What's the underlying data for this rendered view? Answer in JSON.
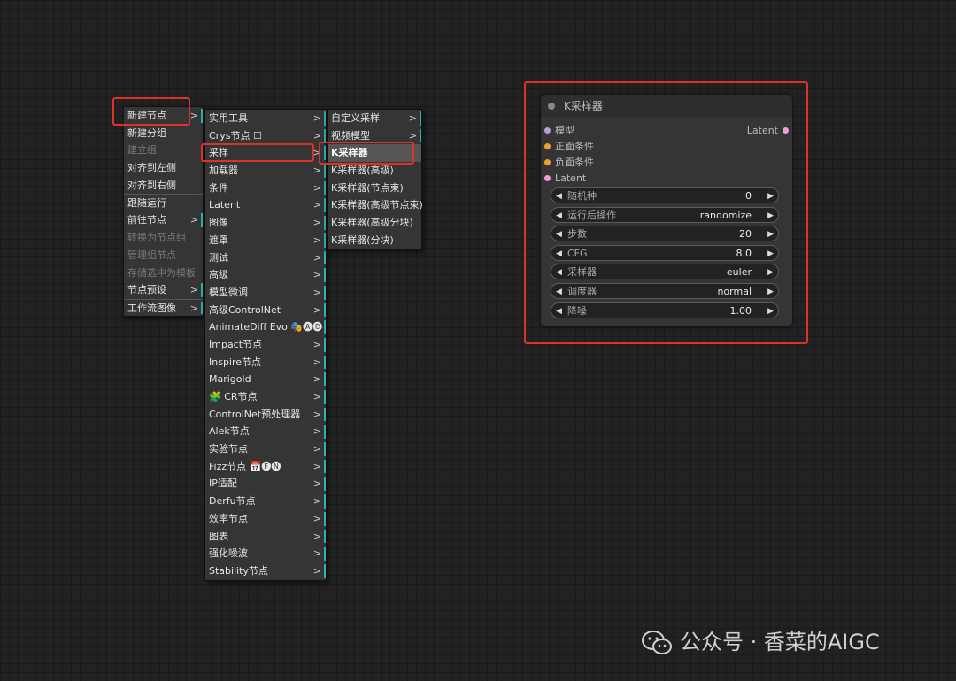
{
  "menu1": {
    "items": [
      {
        "label": "新建节点",
        "arrow": ">",
        "bar": true
      },
      {
        "label": "新建分组"
      },
      {
        "label": "建立组",
        "disabled": true
      },
      {
        "label": "对齐到左侧"
      },
      {
        "label": "对齐到右侧"
      },
      {
        "label": "跟随运行",
        "sep": true
      },
      {
        "label": "前往节点",
        "arrow": ">",
        "bar": true
      },
      {
        "label": "转换为节点组",
        "disabled": true
      },
      {
        "label": "管理组节点",
        "disabled": true
      },
      {
        "label": "存储选中为模板",
        "disabled": true,
        "sep": true
      },
      {
        "label": "节点预设",
        "arrow": ">",
        "bar": true
      },
      {
        "label": "工作流图像",
        "arrow": ">",
        "bar": true,
        "sep": true
      }
    ]
  },
  "menu2": {
    "items": [
      {
        "label": "实用工具",
        "arrow": ">",
        "bar": true
      },
      {
        "label": "Crys节点 ☐",
        "arrow": ">",
        "bar": true
      },
      {
        "label": "采样",
        "arrow": ">",
        "bar": true
      },
      {
        "label": "加载器",
        "arrow": ">",
        "bar": true
      },
      {
        "label": "条件",
        "arrow": ">",
        "bar": true
      },
      {
        "label": "Latent",
        "arrow": ">",
        "bar": true
      },
      {
        "label": "图像",
        "arrow": ">",
        "bar": true
      },
      {
        "label": "遮罩",
        "arrow": ">",
        "bar": true
      },
      {
        "label": "测试",
        "arrow": ">",
        "bar": true
      },
      {
        "label": "高级",
        "arrow": ">",
        "bar": true
      },
      {
        "label": "模型微调",
        "arrow": ">",
        "bar": true
      },
      {
        "label": "高级ControlNet",
        "arrow": ">",
        "bar": true
      },
      {
        "label": "AnimateDiff Evo 🎭🅐🅓",
        "arrow": ">",
        "bar": true
      },
      {
        "label": "Impact节点",
        "arrow": ">",
        "bar": true
      },
      {
        "label": "Inspire节点",
        "arrow": ">",
        "bar": true
      },
      {
        "label": "Marigold",
        "arrow": ">",
        "bar": true
      },
      {
        "label": "🧩 CR节点",
        "arrow": ">",
        "bar": true
      },
      {
        "label": "ControlNet预处理器",
        "arrow": ">",
        "bar": true
      },
      {
        "label": "Alek节点",
        "arrow": ">",
        "bar": true
      },
      {
        "label": "实验节点",
        "arrow": ">",
        "bar": true
      },
      {
        "label": "Fizz节点 📅🅕🅝",
        "arrow": ">",
        "bar": true
      },
      {
        "label": "IP适配",
        "arrow": ">",
        "bar": true
      },
      {
        "label": "Derfu节点",
        "arrow": ">",
        "bar": true
      },
      {
        "label": "效率节点",
        "arrow": ">",
        "bar": true
      },
      {
        "label": "图表",
        "arrow": ">",
        "bar": true
      },
      {
        "label": "强化噪波",
        "arrow": ">",
        "bar": true
      },
      {
        "label": "Stability节点",
        "arrow": ">",
        "bar": true
      }
    ]
  },
  "menu3": {
    "items": [
      {
        "label": "自定义采样",
        "arrow": ">",
        "bar": true
      },
      {
        "label": "视频模型",
        "arrow": ">",
        "bar": true
      },
      {
        "label": "K采样器",
        "hl": true
      },
      {
        "label": "K采样器(高级)"
      },
      {
        "label": "K采样器(节点束)"
      },
      {
        "label": "K采样器(高级节点束)"
      },
      {
        "label": "K采样器(高级分块)"
      },
      {
        "label": "K采样器(分块)"
      }
    ]
  },
  "node": {
    "title": "K采样器",
    "inputs": [
      {
        "label": "模型",
        "color": "#b39ddb"
      },
      {
        "label": "正面条件",
        "color": "#f0a030"
      },
      {
        "label": "负面条件",
        "color": "#f0a030"
      },
      {
        "label": "Latent",
        "color": "#f29bd8"
      }
    ],
    "output": {
      "label": "Latent",
      "color": "#f29bd8"
    },
    "widgets": [
      {
        "label": "随机种",
        "value": "0"
      },
      {
        "label": "运行后操作",
        "value": "randomize"
      },
      {
        "label": "步数",
        "value": "20"
      },
      {
        "label": "CFG",
        "value": "8.0"
      },
      {
        "label": "采样器",
        "value": "euler"
      },
      {
        "label": "调度器",
        "value": "normal"
      },
      {
        "label": "降噪",
        "value": "1.00"
      }
    ]
  },
  "watermark": {
    "text": "公众号 · 香菜的AIGC"
  },
  "colors": {
    "highlight_box": "#e0302b",
    "menu_bar": "#2bb3b3"
  }
}
